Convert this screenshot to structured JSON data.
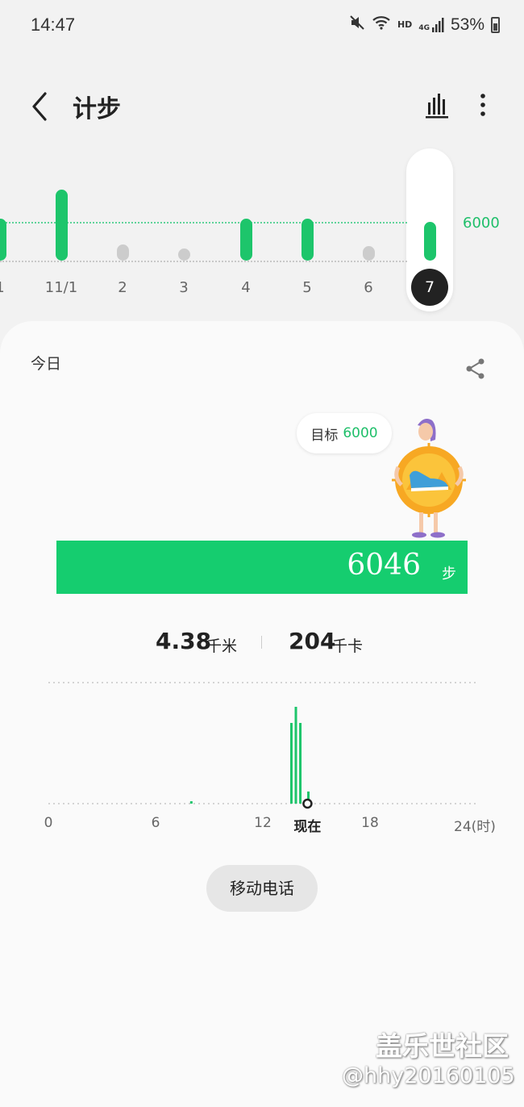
{
  "status_bar": {
    "time": "14:47",
    "hd_label": "HD",
    "network_label": "4G",
    "battery_percent": "53%",
    "icons": [
      "mute-icon",
      "wifi-icon",
      "signal-icon",
      "battery-icon"
    ]
  },
  "header": {
    "title": "计步",
    "back_icon": "chevron-left-icon",
    "trends_icon": "bar-chart-icon",
    "more_icon": "more-vertical-icon"
  },
  "week": {
    "goal_label": "6000",
    "goal": 6000,
    "selected_index": 7,
    "days": [
      {
        "label": "1",
        "steps": 6500,
        "met_goal": true
      },
      {
        "label": "11/1",
        "steps": 11000,
        "met_goal": true
      },
      {
        "label": "2",
        "steps": 2500,
        "met_goal": false
      },
      {
        "label": "3",
        "steps": 900,
        "met_goal": false
      },
      {
        "label": "4",
        "steps": 6500,
        "met_goal": true
      },
      {
        "label": "5",
        "steps": 6500,
        "met_goal": true
      },
      {
        "label": "6",
        "steps": 2300,
        "met_goal": false
      },
      {
        "label": "7",
        "steps": 6046,
        "met_goal": true
      }
    ]
  },
  "today": {
    "label": "今日",
    "share_icon": "share-icon",
    "goal_text": "目标",
    "goal_value": "6000",
    "steps": "6046",
    "steps_unit": "步",
    "distance": "4.38",
    "distance_unit": "千米",
    "calories": "204",
    "calories_unit": "千卡",
    "device_button": "移动电话"
  },
  "chart_data": {
    "type": "bar",
    "xlabel": "",
    "ylabel": "",
    "x_ticks": [
      "0",
      "6",
      "12",
      "现在",
      "18",
      "24(时)"
    ],
    "xlim": [
      0,
      24
    ],
    "now_hour": 14.5,
    "series": [
      {
        "x": [
          8.0,
          13.6,
          13.85,
          14.1,
          14.35,
          14.55
        ],
        "values": [
          30,
          1000,
          1200,
          1000,
          30,
          150
        ]
      }
    ],
    "colors": {
      "bar": "#1dc56b",
      "now_marker": "#222222"
    }
  },
  "colors": {
    "accent_green": "#15cd6f",
    "goal_text_green": "#1fbf6a",
    "inactive_gray": "#cccccc"
  },
  "watermark": {
    "title": "盖乐世社区",
    "user": "@hhy20160105"
  }
}
